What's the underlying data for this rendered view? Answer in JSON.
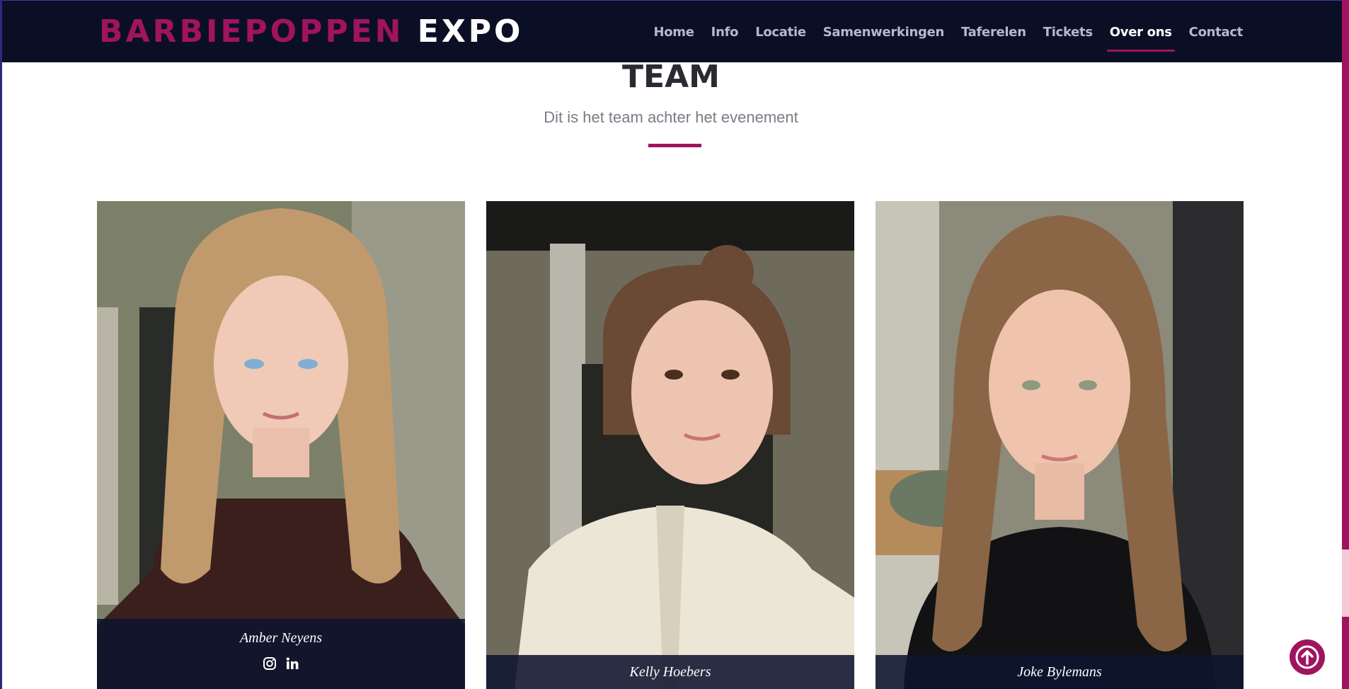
{
  "brand": {
    "part1": "BARBIEPOPPEN",
    "part2": "EXPO"
  },
  "nav": {
    "items": [
      {
        "label": "Home"
      },
      {
        "label": "Info"
      },
      {
        "label": "Locatie"
      },
      {
        "label": "Samenwerkingen"
      },
      {
        "label": "Taferelen"
      },
      {
        "label": "Tickets"
      },
      {
        "label": "Over ons",
        "active": true
      },
      {
        "label": "Contact"
      }
    ]
  },
  "section": {
    "title": "TEAM",
    "subtitle": "Dit is het team achter het evenement"
  },
  "team": [
    {
      "name": "Amber Neyens",
      "socials": [
        "instagram-icon",
        "linkedin-icon"
      ]
    },
    {
      "name": "Kelly Hoebers"
    },
    {
      "name": "Joke Bylemans"
    }
  ],
  "colors": {
    "accent": "#a0135f",
    "navbar": "#0b0f26",
    "caption": "#0e1430"
  },
  "icons": {
    "back_to_top": "arrow-up-icon"
  }
}
